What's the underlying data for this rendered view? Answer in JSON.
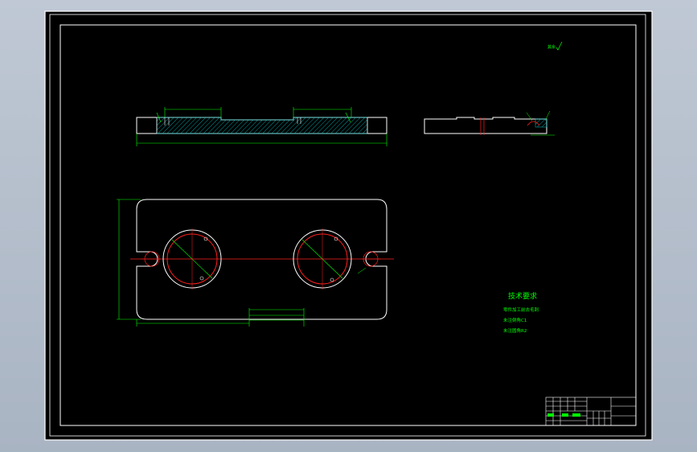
{
  "drawing": {
    "roughness_symbol": "其余",
    "tech_requirements": {
      "title": "技术要求",
      "items": [
        "零件加工前去毛刺",
        "未注倒角C1",
        "未注圆角R2"
      ]
    },
    "title_block": {
      "scale": "1:1",
      "material": "45"
    }
  },
  "colors": {
    "sheet": "#000000",
    "frame": "#ffffff",
    "centerline": "#ff2020",
    "dimension": "#00ff00",
    "hatch": "#00c0c0",
    "title_block": "#ffffff"
  }
}
